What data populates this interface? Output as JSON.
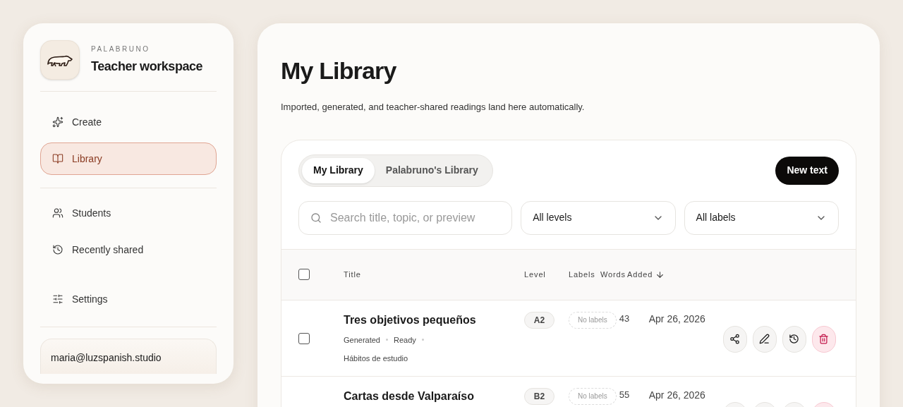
{
  "sidebar": {
    "brand": "PALABRUNO",
    "workspace": "Teacher workspace",
    "items": [
      {
        "label": "Create",
        "selected": false
      },
      {
        "label": "Library",
        "selected": true
      },
      {
        "label": "Students",
        "selected": false
      },
      {
        "label": "Recently shared",
        "selected": false
      },
      {
        "label": "Settings",
        "selected": false
      }
    ],
    "account": "maria@luzspanish.studio"
  },
  "page": {
    "title": "My Library",
    "subtitle": "Imported, generated, and teacher-shared readings land here automatically."
  },
  "tabs": [
    {
      "label": "My Library",
      "selected": true
    },
    {
      "label": "Palabruno's Library",
      "selected": false
    }
  ],
  "new_button": "New text",
  "search": {
    "placeholder": "Search title, topic, or preview"
  },
  "filters": [
    "All levels",
    "All labels"
  ],
  "table": {
    "select_all_checked": false,
    "columns": [
      "Title",
      "Level",
      "Labels",
      "Words",
      "Added"
    ],
    "rows": [
      {
        "checked": false,
        "title": "Tres objetivos pequeños",
        "meta": [
          "Generated",
          "Ready"
        ],
        "topic": "Hábitos de estudio",
        "level": "A2",
        "labels": "No labels",
        "words": "43",
        "added": "Apr 26, 2026"
      },
      {
        "title": "Cartas desde Valparaíso",
        "level": "B2",
        "labels": "No labels",
        "words": "55",
        "added": "Apr 26, 2026"
      }
    ]
  }
}
